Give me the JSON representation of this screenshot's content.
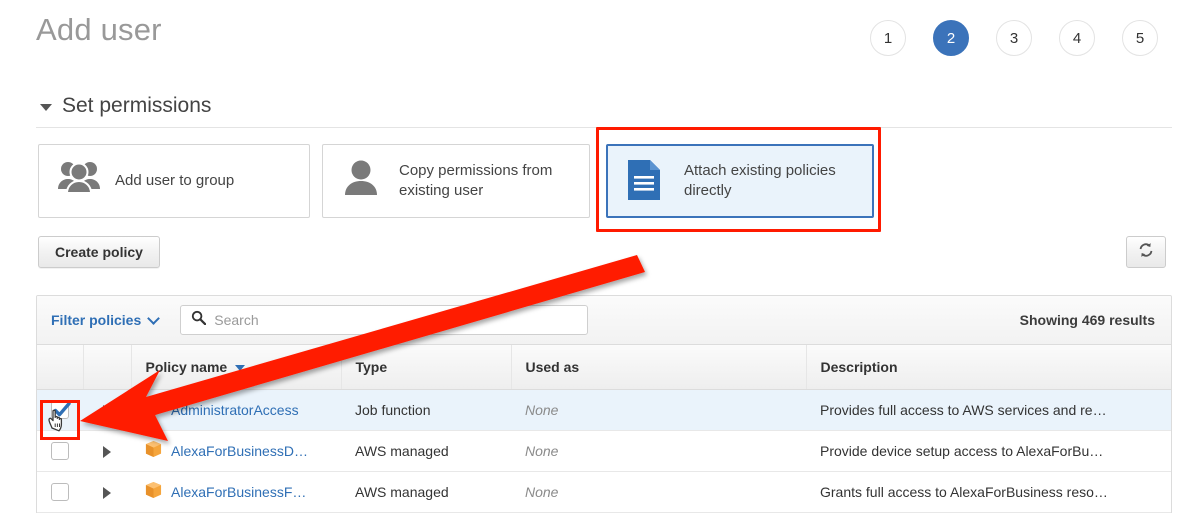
{
  "header": {
    "title": "Add user",
    "steps": [
      {
        "label": "1",
        "active": false
      },
      {
        "label": "2",
        "active": true
      },
      {
        "label": "3",
        "active": false
      },
      {
        "label": "4",
        "active": false
      },
      {
        "label": "5",
        "active": false
      }
    ]
  },
  "section": {
    "title": "Set permissions"
  },
  "permission_options": [
    {
      "label": "Add user to group",
      "icon": "users-group-icon",
      "selected": false
    },
    {
      "label": "Copy permissions from existing user",
      "icon": "user-icon",
      "selected": false
    },
    {
      "label": "Attach existing policies directly",
      "icon": "document-icon",
      "selected": true
    }
  ],
  "toolbar": {
    "create_policy_label": "Create policy",
    "refresh_icon": "refresh-icon"
  },
  "filter_bar": {
    "filter_label": "Filter policies",
    "filter_chevron": "chevron-down-icon",
    "search_icon": "search-icon",
    "search_value": "",
    "search_placeholder": "Search",
    "results_text": "Showing 469 results"
  },
  "table": {
    "columns": [
      "",
      "",
      "Policy name",
      "Type",
      "Used as",
      "Description"
    ],
    "sort_column": "Policy name",
    "sort_icon": "sort-descending-caret-icon",
    "rows": [
      {
        "checked": true,
        "selected": true,
        "policy_icon": "policy-cube-icon",
        "name": "AdministratorAccess",
        "type": "Job function",
        "used_as": "None",
        "description": "Provides full access to AWS services and re…"
      },
      {
        "checked": false,
        "selected": false,
        "policy_icon": "policy-cube-icon",
        "name": "AlexaForBusinessD…",
        "type": "AWS managed",
        "used_as": "None",
        "description": "Provide device setup access to AlexaForBu…"
      },
      {
        "checked": false,
        "selected": false,
        "policy_icon": "policy-cube-icon",
        "name": "AlexaForBusinessF…",
        "type": "AWS managed",
        "used_as": "None",
        "description": "Grants full access to AlexaForBusiness reso…"
      }
    ]
  },
  "annotations": {
    "highlight_color": "#ff1a00",
    "arrow_from": "attach-existing-policies-card",
    "arrow_to": "first-row-checkbox"
  },
  "colors": {
    "accent_blue": "#3b73ba",
    "link_blue": "#2f6fb5",
    "selected_row_bg": "#eaf3fb",
    "policy_icon_orange": "#f0962b"
  }
}
